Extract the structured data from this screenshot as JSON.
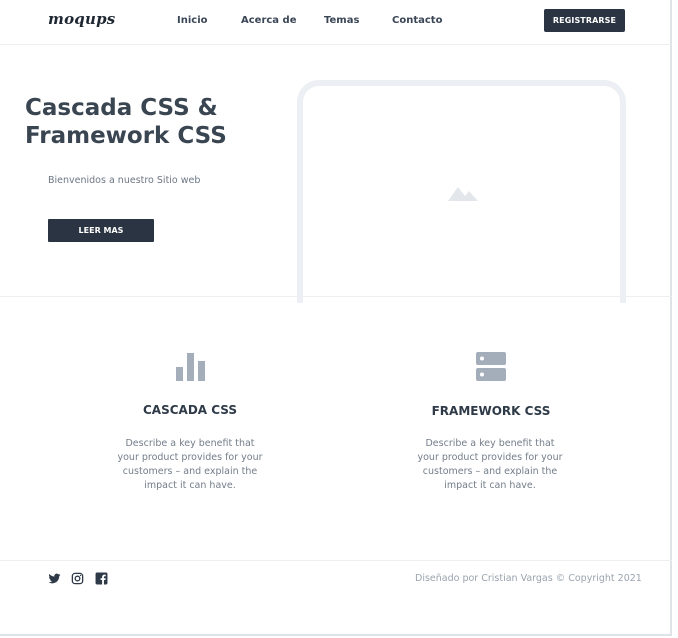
{
  "header": {
    "logo": "moqups",
    "nav": [
      "Inicio",
      "Acerca de",
      "Temas",
      "Contacto"
    ],
    "register_label": "REGISTRARSE"
  },
  "hero": {
    "title": "Cascada CSS & Framework CSS",
    "subtitle": "Bienvenidos a nuestro Sitio web",
    "button_label": "LEER MAS",
    "image_icon": "image-placeholder-icon"
  },
  "features": [
    {
      "icon": "bar-chart-icon",
      "title": "CASCADA CSS",
      "description": "Describe a key benefit that your product provides for your customers – and explain the impact it can have."
    },
    {
      "icon": "server-icon",
      "title": "FRAMEWORK CSS",
      "description": "Describe a key benefit that your product provides for your customers – and explain the impact it can have."
    }
  ],
  "footer": {
    "social_icons": [
      "twitter-icon",
      "instagram-icon",
      "facebook-icon"
    ],
    "copyright": "Diseñado por Cristian Vargas © Copyright 2021"
  },
  "colors": {
    "dark": "#2b3442",
    "text": "#3a4552",
    "muted": "#737d8a",
    "icon": "#a4adba",
    "border": "#eceff3"
  }
}
